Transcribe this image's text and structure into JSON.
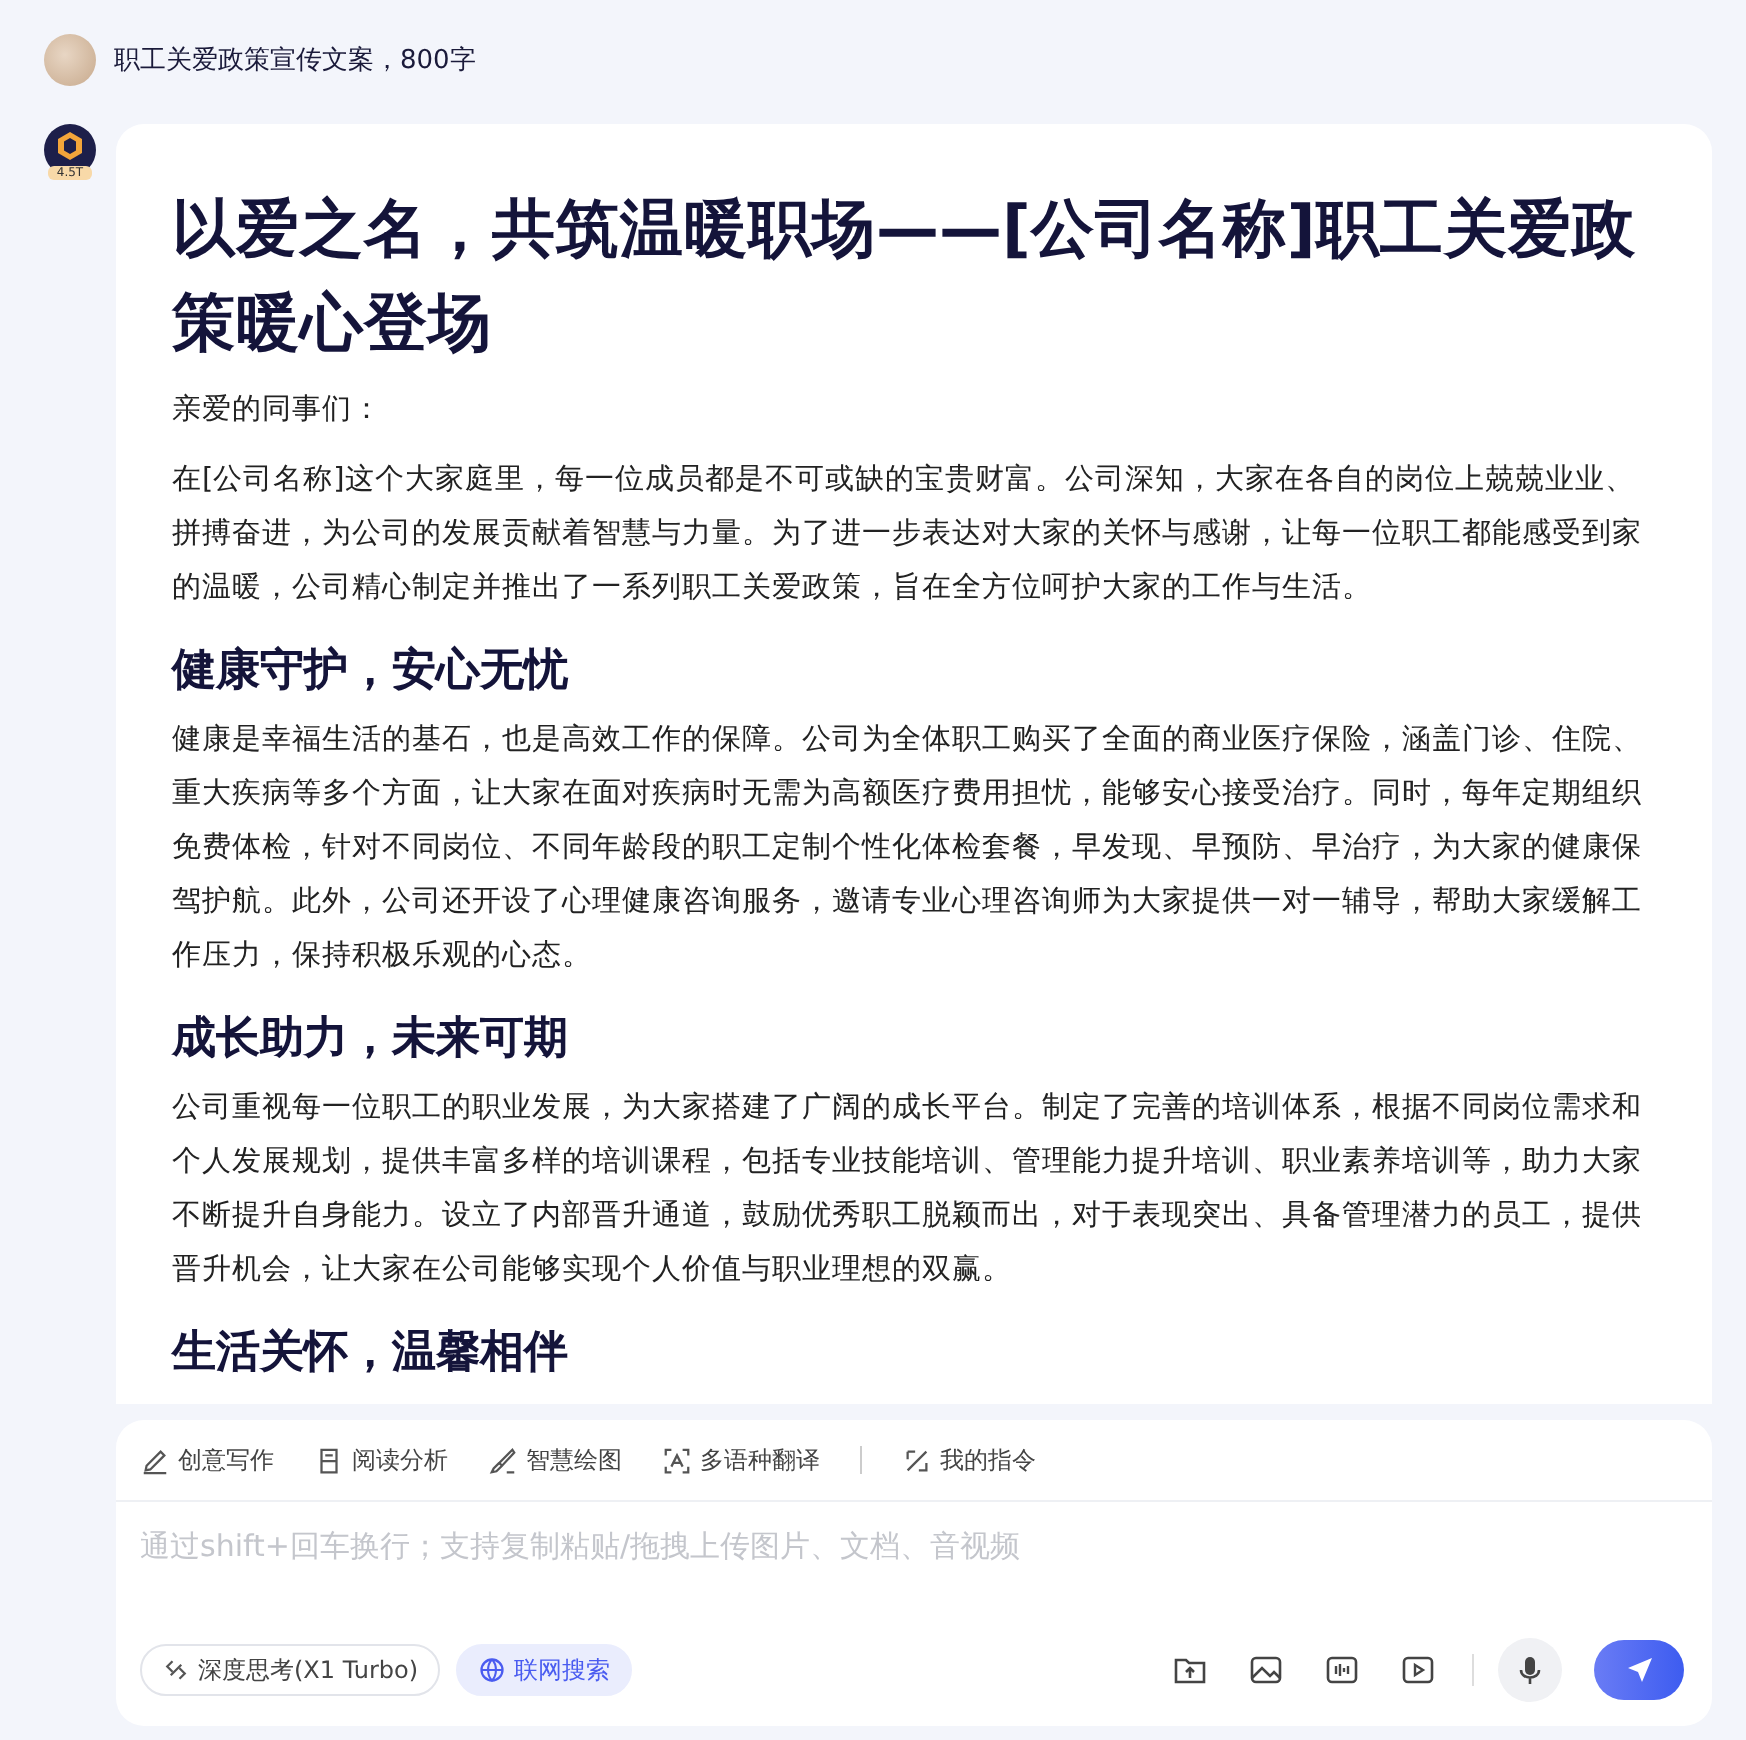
{
  "user_message": {
    "text": "职工关爱政策宣传文案，800字"
  },
  "bot": {
    "badge": "4.5T"
  },
  "article": [
    {
      "kind": "title",
      "text": "以爱之名，共筑温暖职场——[公司名称]职工关爱政策暖心登场"
    },
    {
      "kind": "paragraph",
      "text": "亲爱的同事们："
    },
    {
      "kind": "paragraph",
      "text": "在[公司名称]这个大家庭里，每一位成员都是不可或缺的宝贵财富。公司深知，大家在各自的岗位上兢兢业业、拼搏奋进，为公司的发展贡献着智慧与力量。为了进一步表达对大家的关怀与感谢，让每一位职工都能感受到家的温暖，公司精心制定并推出了一系列职工关爱政策，旨在全方位呵护大家的工作与生活。"
    },
    {
      "kind": "heading",
      "text": "健康守护，安心无忧"
    },
    {
      "kind": "paragraph",
      "text": "健康是幸福生活的基石，也是高效工作的保障。公司为全体职工购买了全面的商业医疗保险，涵盖门诊、住院、重大疾病等多个方面，让大家在面对疾病时无需为高额医疗费用担忧，能够安心接受治疗。同时，每年定期组织免费体检，针对不同岗位、不同年龄段的职工定制个性化体检套餐，早发现、早预防、早治疗，为大家的健康保驾护航。此外，公司还开设了心理健康咨询服务，邀请专业心理咨询师为大家提供一对一辅导，帮助大家缓解工作压力，保持积极乐观的心态。"
    },
    {
      "kind": "heading",
      "text": "成长助力，未来可期"
    },
    {
      "kind": "paragraph",
      "text": "公司重视每一位职工的职业发展，为大家搭建了广阔的成长平台。制定了完善的培训体系，根据不同岗位需求和个人发展规划，提供丰富多样的培训课程，包括专业技能培训、管理能力提升培训、职业素养培训等，助力大家不断提升自身能力。设立了内部晋升通道，鼓励优秀职工脱颖而出，对于表现突出、具备管理潜力的员工，提供晋升机会，让大家在公司能够实现个人价值与职业理想的双赢。"
    },
    {
      "kind": "heading",
      "text": "生活关怀，温馨相伴"
    }
  ],
  "composer": {
    "tools": [
      {
        "kind": "pen",
        "label": "创意写作"
      },
      {
        "kind": "book",
        "label": "阅读分析"
      },
      {
        "kind": "brush",
        "label": "智慧绘图"
      },
      {
        "kind": "translate",
        "label": "多语种翻译"
      },
      {
        "kind": "command",
        "label": "我的指令"
      }
    ],
    "placeholder": "通过shift+回车换行；支持复制粘贴/拖拽上传图片、文档、音视频",
    "modes": [
      {
        "kind": "think",
        "label": "深度思考(X1 Turbo)",
        "selected": false
      },
      {
        "kind": "web",
        "label": "联网搜索",
        "selected": true
      }
    ]
  }
}
